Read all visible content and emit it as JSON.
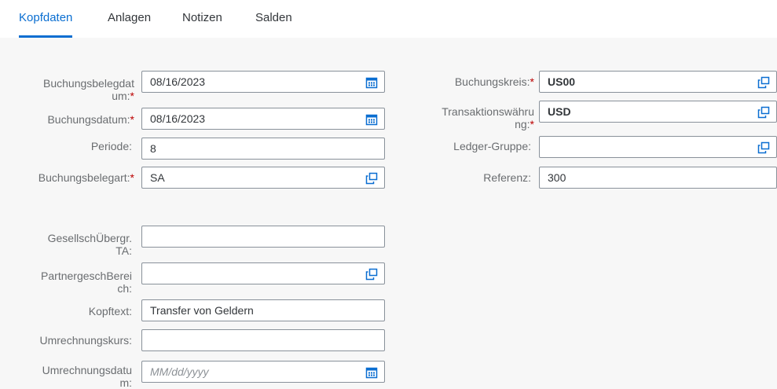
{
  "tabs": [
    {
      "label": "Kopfdaten",
      "active": true
    },
    {
      "label": "Anlagen",
      "active": false
    },
    {
      "label": "Notizen",
      "active": false
    },
    {
      "label": "Salden",
      "active": false
    }
  ],
  "required_marker": "*",
  "left": {
    "buchungsbelegdatum": {
      "label_line1": "Buchungsbelegdat",
      "label_line2": "um:",
      "value": "08/16/2023",
      "icon": "calendar-icon"
    },
    "buchungsdatum": {
      "label": "Buchungsdatum:",
      "value": "08/16/2023",
      "icon": "calendar-icon"
    },
    "periode": {
      "label": "Periode:",
      "value": "8"
    },
    "buchungsbelegart": {
      "label": "Buchungsbelegart:",
      "value": "SA",
      "icon": "value-help-icon"
    },
    "gesellschuebergr": {
      "label_line1": "GesellschÜbergr.",
      "label_line2": "TA:",
      "value": ""
    },
    "partnergeschbereich": {
      "label_line1": "PartnergeschBerei",
      "label_line2": "ch:",
      "value": "",
      "icon": "value-help-icon"
    },
    "kopftext": {
      "label": "Kopftext:",
      "value": "Transfer von Geldern"
    },
    "umrechnungskurs": {
      "label": "Umrechnungskurs:",
      "value": ""
    },
    "umrechnungsdatum": {
      "label_line1": "Umrechnungsdatu",
      "label_line2": "m:",
      "placeholder": "MM/dd/yyyy",
      "icon": "calendar-icon"
    }
  },
  "right": {
    "buchungskreis": {
      "label": "Buchungskreis:",
      "value": "US00",
      "icon": "value-help-icon"
    },
    "transaktionswaehrung": {
      "label_line1": "Transaktionswähru",
      "label_line2": "ng:",
      "value": "USD",
      "icon": "value-help-icon"
    },
    "ledger_gruppe": {
      "label": "Ledger-Gruppe:",
      "value": "",
      "icon": "value-help-icon"
    },
    "referenz": {
      "label": "Referenz:",
      "value": "300"
    }
  },
  "colors": {
    "accent": "#0a6ed1",
    "required": "#bb0000",
    "label": "#6a6d70",
    "border": "#89919a"
  }
}
